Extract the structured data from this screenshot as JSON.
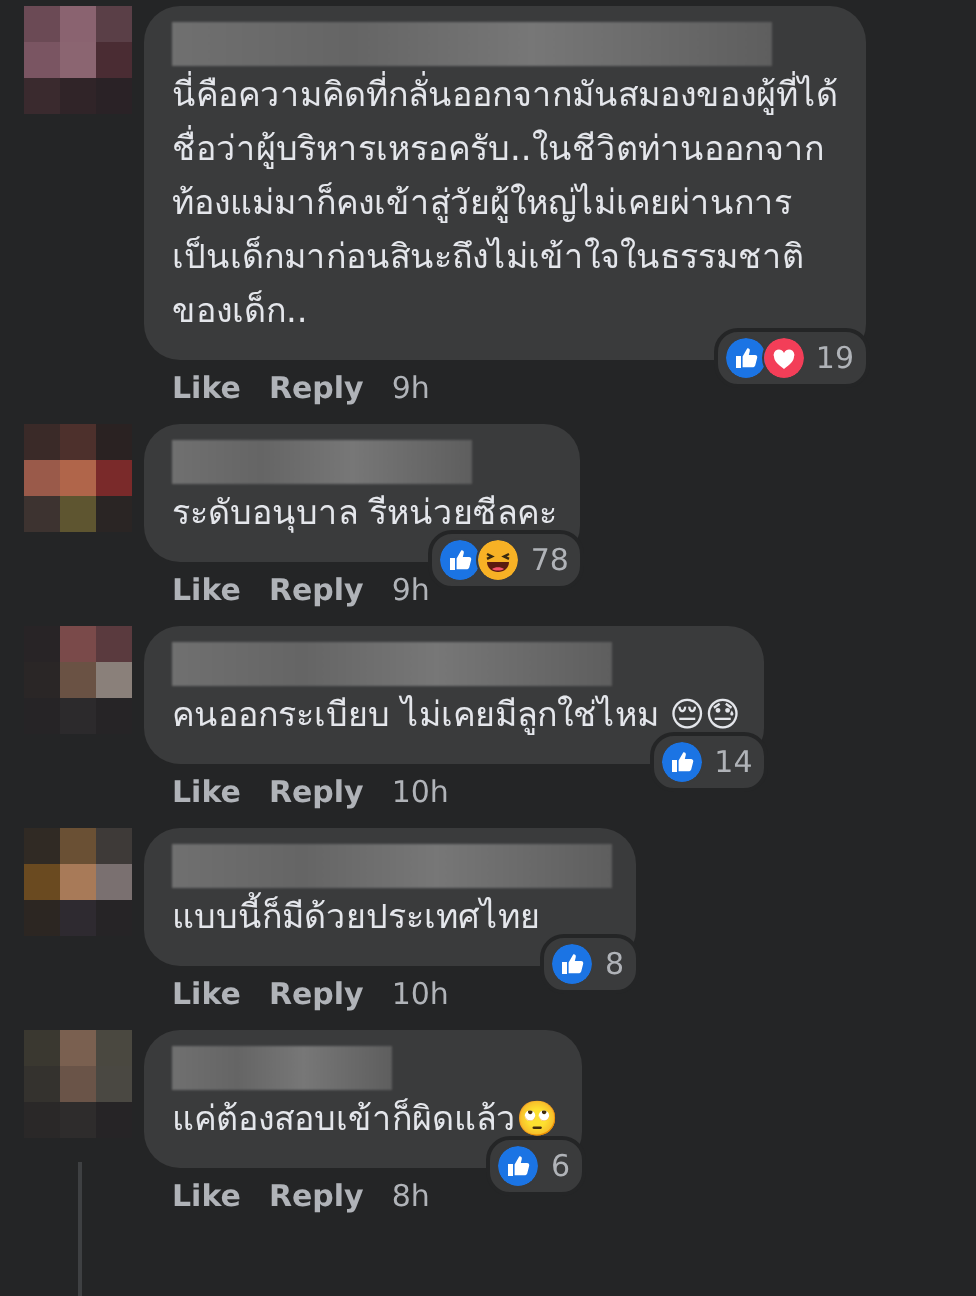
{
  "comments": [
    {
      "text": "นี่คือความคิดที่กลั่นออกจากมันสมองของผู้ที่ได้ชื่อว่าผู้บริหารเหรอครับ..ในชีวิตท่านออกจากท้องแม่มาก็คงเข้าสู่วัยผู้ใหญ่ไม่เคยผ่านการเป็นเด็กมาก่อนสินะถึงไม่เข้าใจในธรรมชาติของเด็ก..",
      "reactions": [
        {
          "kind": "like"
        },
        {
          "kind": "love"
        }
      ],
      "count": "19",
      "actions": [
        "Like",
        "Reply"
      ],
      "time": "9h"
    },
    {
      "text": "ระดับอนุบาล รีหน่วยซีลคะ",
      "reactions": [
        {
          "kind": "like"
        },
        {
          "kind": "haha"
        }
      ],
      "count": "78",
      "actions": [
        "Like",
        "Reply"
      ],
      "time": "9h"
    },
    {
      "text": "คนออกระเบียบ ไม่เคยมีลูกใช่ไหม 😔😓",
      "reactions": [
        {
          "kind": "like"
        }
      ],
      "count": "14",
      "actions": [
        "Like",
        "Reply"
      ],
      "time": "10h"
    },
    {
      "text": "แบบนี้ก็มีด้วยประเทศไทย",
      "reactions": [
        {
          "kind": "like"
        }
      ],
      "count": "8",
      "actions": [
        "Like",
        "Reply"
      ],
      "time": "10h"
    },
    {
      "text": "แค่ต้องสอบเข้าก็ผิดแล้ว🙄",
      "reactions": [
        {
          "kind": "like"
        }
      ],
      "count": "6",
      "actions": [
        "Like",
        "Reply"
      ],
      "time": "8h"
    }
  ]
}
